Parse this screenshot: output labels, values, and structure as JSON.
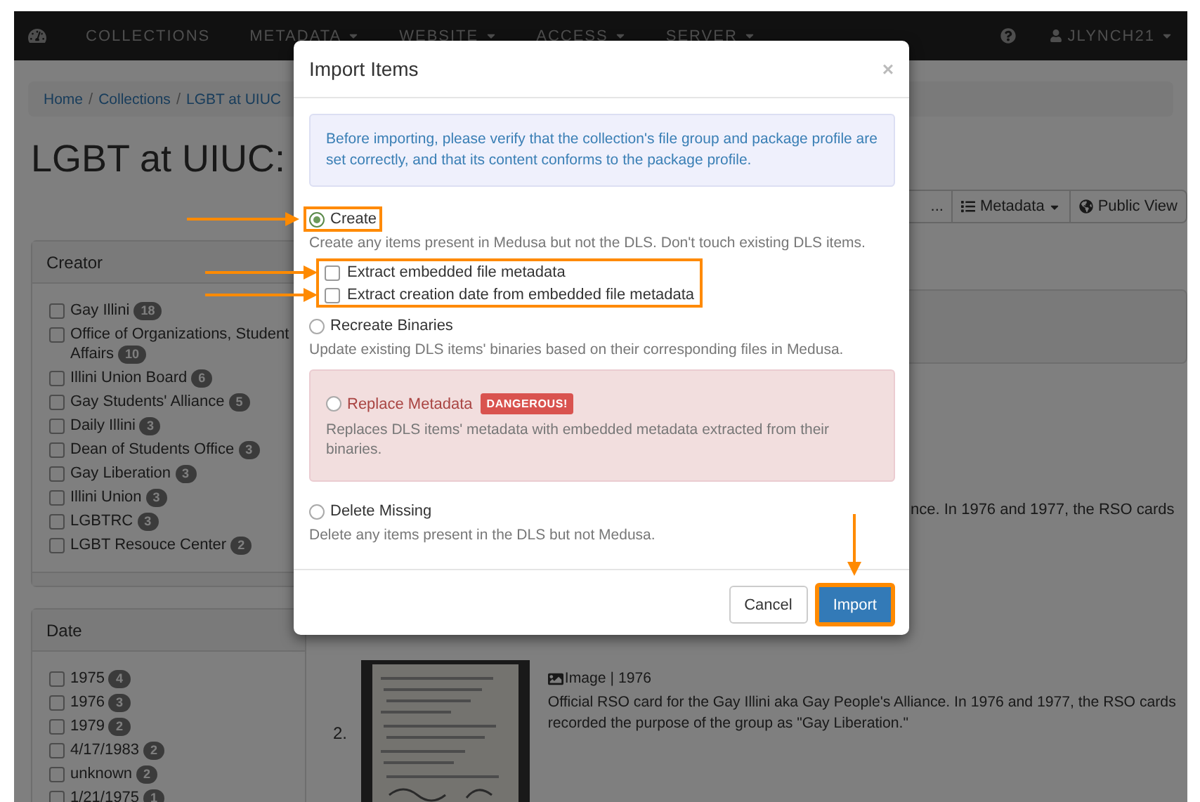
{
  "navbar": {
    "items": [
      {
        "label": "COLLECTIONS",
        "dropdown": false
      },
      {
        "label": "METADATA",
        "dropdown": true
      },
      {
        "label": "WEBSITE",
        "dropdown": true
      },
      {
        "label": "ACCESS",
        "dropdown": true
      },
      {
        "label": "SERVER",
        "dropdown": true
      }
    ],
    "user": "JLYNCH21"
  },
  "breadcrumb": {
    "separator": "/",
    "items": [
      "Home",
      "Collections",
      "LGBT at UIUC"
    ]
  },
  "page_title": "LGBT at UIUC:",
  "toolbar": [
    {
      "label": "...",
      "dropdown": false
    },
    {
      "label": "Metadata",
      "dropdown": true
    },
    {
      "label": "Public View",
      "dropdown": false
    }
  ],
  "facets": [
    {
      "title": "Creator",
      "terms": [
        {
          "label": "Gay Illini",
          "count": "18",
          "checked": false
        },
        {
          "label": "Office of Organizations, Student Affairs",
          "count": "10",
          "checked": false
        },
        {
          "label": "Illini Union Board",
          "count": "6",
          "checked": false
        },
        {
          "label": "Gay Students' Alliance",
          "count": "5",
          "checked": false
        },
        {
          "label": "Daily Illini",
          "count": "3",
          "checked": false
        },
        {
          "label": "Dean of Students Office",
          "count": "3",
          "checked": false
        },
        {
          "label": "Gay Liberation",
          "count": "3",
          "checked": false
        },
        {
          "label": "Illini Union",
          "count": "3",
          "checked": false
        },
        {
          "label": "LGBTRC",
          "count": "3",
          "checked": false
        },
        {
          "label": "LGBT Resouce Center",
          "count": "2",
          "checked": false
        }
      ]
    },
    {
      "title": "Date",
      "terms": [
        {
          "label": "1975",
          "count": "4",
          "checked": false
        },
        {
          "label": "1976",
          "count": "3",
          "checked": false
        },
        {
          "label": "1979",
          "count": "2",
          "checked": false
        },
        {
          "label": "4/17/1983",
          "count": "2",
          "checked": false
        },
        {
          "label": "unknown",
          "count": "2",
          "checked": false
        },
        {
          "label": "1/21/1975",
          "count": "1",
          "checked": false
        }
      ]
    }
  ],
  "results": {
    "partial_text": "nce. In 1976 and 1977, the RSO cards",
    "items": [
      {
        "number": "2.",
        "kind": "picture",
        "type": "Image | 1976",
        "description": "Official RSO card for the Gay Illini aka Gay People's Alliance. In 1976 and 1977, the RSO cards recorded the purpose of the group as \"Gay Liberation.\""
      }
    ]
  },
  "modal": {
    "title": "Import Items",
    "close": "×",
    "notice": "Before importing, please verify that the collection's file group and package profile are set correctly, and that its content conforms to the package profile.",
    "options": [
      {
        "label": "Create",
        "selected": true,
        "danger": false,
        "highlighted": true,
        "description": "Create any items present in Medusa but not the DLS. Don't touch existing DLS items.",
        "suboptions_highlighted": true,
        "suboptions": [
          {
            "label": "Extract embedded file metadata",
            "checked": false
          },
          {
            "label": "Extract creation date from embedded file metadata",
            "checked": false
          }
        ]
      },
      {
        "label": "Recreate Binaries",
        "selected": false,
        "danger": false,
        "highlighted": false,
        "description": "Update existing DLS items' binaries based on their corresponding files in Medusa."
      },
      {
        "label": "Replace Metadata",
        "selected": false,
        "danger": true,
        "badge": "DANGEROUS!",
        "highlighted": false,
        "description": "Replaces DLS items' metadata with embedded metadata extracted from their binaries."
      },
      {
        "label": "Delete Missing",
        "selected": false,
        "danger": false,
        "highlighted": false,
        "description": "Delete any items present in the DLS but not Medusa."
      }
    ],
    "buttons": [
      {
        "label": "Cancel",
        "kind": "default",
        "highlighted": false
      },
      {
        "label": "Import",
        "kind": "primary",
        "highlighted": true
      }
    ]
  }
}
